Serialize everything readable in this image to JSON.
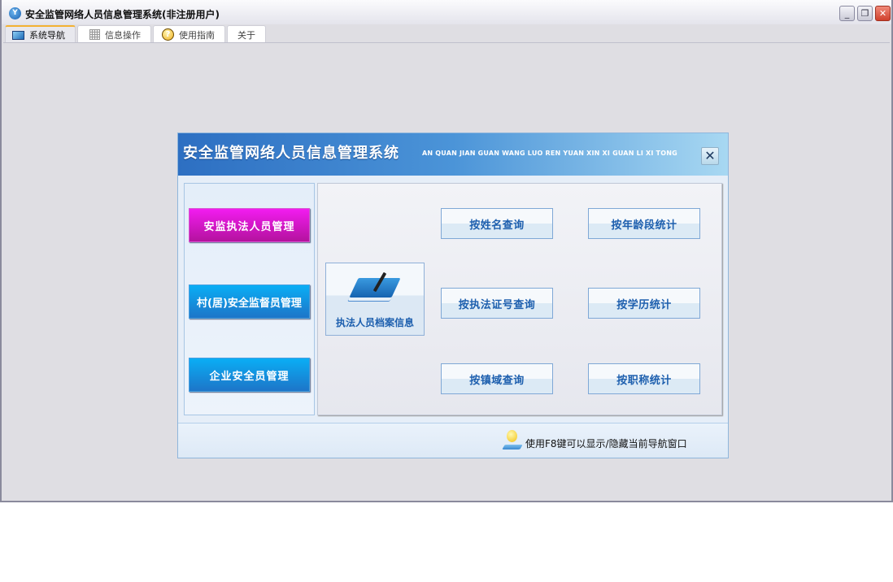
{
  "window": {
    "title": "安全监管网络人员信息管理系统(非注册用户)",
    "min": "_",
    "restore": "❐",
    "close": "✕"
  },
  "tabs": [
    {
      "label": "系统导航"
    },
    {
      "label": "信息操作"
    },
    {
      "label": "使用指南"
    },
    {
      "label": "关于"
    }
  ],
  "dialog": {
    "title": "安全监管网络人员信息管理系统",
    "pinyin": "AN QUAN JIAN GUAN WANG LUO REN YUAN XIN XI GUAN LI XI TONG",
    "close": "✕",
    "left_buttons": [
      {
        "label": "安监执法人员管理"
      },
      {
        "label": "村(居)安全监督员管理"
      },
      {
        "label": "企业安全员管理"
      }
    ],
    "archive": "执法人员档案信息",
    "queries": [
      {
        "label": "按姓名查询"
      },
      {
        "label": "按执法证号查询"
      },
      {
        "label": "按镇域查询"
      }
    ],
    "stats": [
      {
        "label": "按年龄段统计"
      },
      {
        "label": "按学历统计"
      },
      {
        "label": "按职称统计"
      }
    ],
    "hint": "使用F8键可以显示/隐藏当前导航窗口"
  }
}
